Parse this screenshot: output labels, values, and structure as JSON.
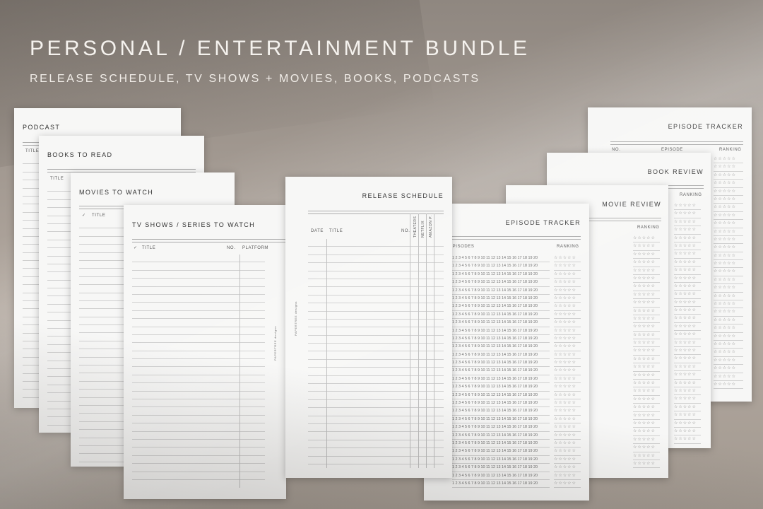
{
  "header": {
    "title": "PERSONAL / ENTERTAINMENT BUNDLE",
    "subtitle": "RELEASE SCHEDULE, TV SHOWS + MOVIES, BOOKS, PODCASTS"
  },
  "pages": {
    "podcast": {
      "title": "PODCAST",
      "col_title": "TITLE"
    },
    "books": {
      "title": "BOOKS TO READ",
      "col_title": "TITLE"
    },
    "movies": {
      "title": "MOVIES TO WATCH",
      "col_check": "✓",
      "col_title": "TITLE"
    },
    "tv": {
      "title": "TV SHOWS / SERIES TO WATCH",
      "col_check": "✓",
      "col_title": "TITLE",
      "col_no": "NO.",
      "col_platform": "PLATFORM"
    },
    "release": {
      "title": "RELEASE SCHEDULE",
      "col_date": "DATE",
      "col_title": "TITLE",
      "col_no": "NO.",
      "col_theaters": "THEATERS",
      "col_netflix": "NETFLIX",
      "col_amazon": "AMAZON P.",
      "brand": "PAPERTREE designs"
    },
    "episode_front": {
      "title": "EPISODE TRACKER",
      "col_episodes": "EPISODES",
      "col_ranking": "RANKING",
      "numbers": "1 2 3 4 5 6 7 8 9 10 11 12 13 14 15 16 17 18 19 20",
      "stars": "☆☆☆☆☆"
    },
    "movie_review": {
      "title": "MOVIE REVIEW",
      "col_ranking": "RANKING",
      "stars": "☆☆☆☆☆"
    },
    "book_review": {
      "title": "BOOK REVIEW",
      "col_ranking": "RANKING",
      "stars": "☆☆☆☆☆"
    },
    "episode_back": {
      "title": "EPISODE TRACKER",
      "col_no": "NO.",
      "col_episode": "EPISODE",
      "col_ranking": "RANKING",
      "stars": "☆☆☆☆☆"
    }
  }
}
